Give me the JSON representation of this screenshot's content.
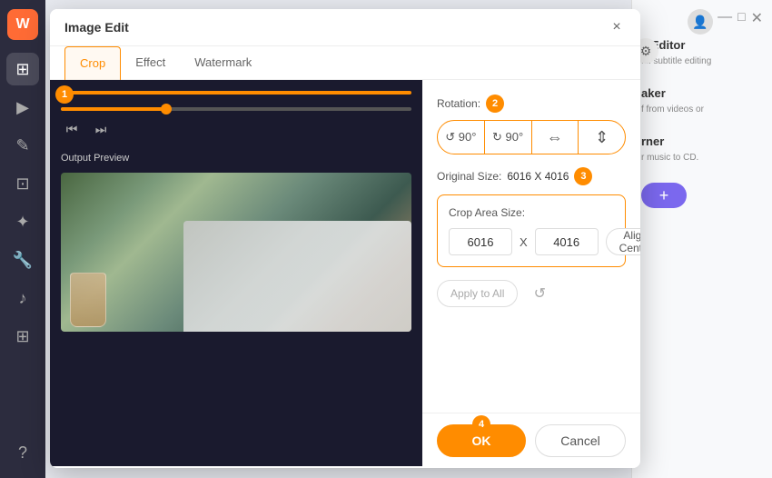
{
  "app": {
    "title": "Image Edit"
  },
  "modal": {
    "title": "Image Edit",
    "close_label": "×"
  },
  "tabs": [
    {
      "id": "crop",
      "label": "Crop",
      "active": true
    },
    {
      "id": "effect",
      "label": "Effect",
      "active": false
    },
    {
      "id": "watermark",
      "label": "Watermark",
      "active": false
    }
  ],
  "steps": {
    "step1": "1",
    "step2": "2",
    "step3": "3",
    "step4": "4"
  },
  "rotation": {
    "label": "Rotation:",
    "buttons": [
      {
        "id": "rot-ccw",
        "icon": "↺ 90°",
        "label": "90° counter-clockwise"
      },
      {
        "id": "rot-cw",
        "icon": "↻ 90°",
        "label": "90° clockwise"
      },
      {
        "id": "flip-h",
        "icon": "⇔",
        "label": "Flip horizontal"
      },
      {
        "id": "flip-v",
        "icon": "⇕",
        "label": "Flip vertical"
      }
    ]
  },
  "original_size": {
    "label": "Original Size:",
    "value": "6016 X 4016"
  },
  "crop_area": {
    "label": "Crop Area Size:",
    "width": "6016",
    "height": "4016",
    "x_label": "X",
    "align_btn": "Align Center"
  },
  "bottom_controls": {
    "apply_all_label": "Apply to All",
    "reset_label": "↺"
  },
  "footer": {
    "ok_label": "OK",
    "cancel_label": "Cancel"
  },
  "preview": {
    "output_label": "Output Preview"
  },
  "sidebar": {
    "items": [
      {
        "id": "home",
        "icon": "⊞"
      },
      {
        "id": "media",
        "icon": "▶"
      },
      {
        "id": "edit",
        "icon": "✎"
      },
      {
        "id": "compress",
        "icon": "⊡"
      },
      {
        "id": "effects",
        "icon": "✦"
      },
      {
        "id": "tools",
        "icon": "⚙"
      },
      {
        "id": "audio",
        "icon": "♪"
      },
      {
        "id": "more",
        "icon": "⊞"
      }
    ]
  },
  "right_panel": {
    "editor_title": "e Editor",
    "editor_sub": "ful subtitle editing",
    "maker_title": "aker",
    "maker_sub": "f from videos or",
    "burner_title": "rner",
    "burner_sub": "r music to CD."
  },
  "colors": {
    "accent": "#ff8c00",
    "sidebar_bg": "#2c2c3e",
    "modal_bg": "#ffffff"
  }
}
